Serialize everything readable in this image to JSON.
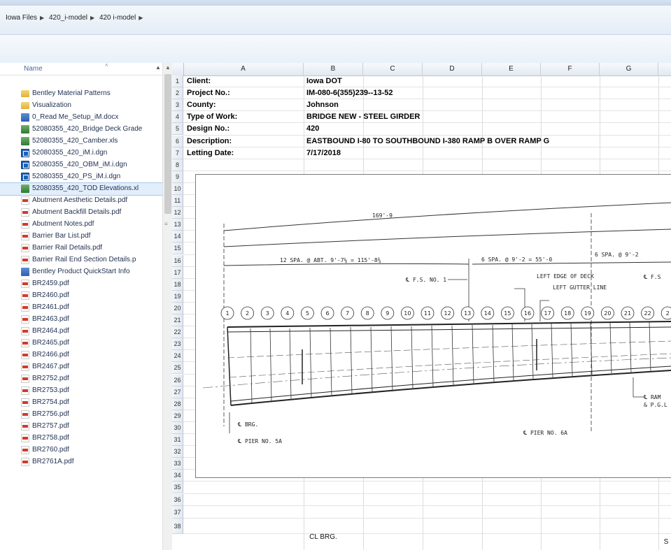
{
  "breadcrumb": [
    "Iowa Files",
    "420_i-model",
    "420 i-model"
  ],
  "file_pane": {
    "header": "Name",
    "items": [
      {
        "name": "Bentley Material Patterns",
        "type": "folder"
      },
      {
        "name": "Visualization",
        "type": "folder"
      },
      {
        "name": "0_Read Me_Setup_iM.docx",
        "type": "doc"
      },
      {
        "name": "52080355_420_Bridge Deck Grade",
        "type": "xls"
      },
      {
        "name": "52080355_420_Camber.xls",
        "type": "xls"
      },
      {
        "name": "52080355_420_iM.i.dgn",
        "type": "dgn"
      },
      {
        "name": "52080355_420_OBM_iM.i.dgn",
        "type": "dgn"
      },
      {
        "name": "52080355_420_PS_iM.i.dgn",
        "type": "dgn"
      },
      {
        "name": "52080355_420_TOD Elevations.xl",
        "type": "xls",
        "selected": true
      },
      {
        "name": "Abutment Aesthetic Details.pdf",
        "type": "pdf"
      },
      {
        "name": "Abutment Backfill Details.pdf",
        "type": "pdf"
      },
      {
        "name": "Abutment Notes.pdf",
        "type": "pdf"
      },
      {
        "name": "Barrier Bar List.pdf",
        "type": "pdf"
      },
      {
        "name": "Barrier Rail Details.pdf",
        "type": "pdf"
      },
      {
        "name": "Barrier Rail End Section Details.p",
        "type": "pdf"
      },
      {
        "name": "Bentley Product QuickStart Info",
        "type": "doc"
      },
      {
        "name": "BR2459.pdf",
        "type": "pdf"
      },
      {
        "name": "BR2460.pdf",
        "type": "pdf"
      },
      {
        "name": "BR2461.pdf",
        "type": "pdf"
      },
      {
        "name": "BR2463.pdf",
        "type": "pdf"
      },
      {
        "name": "BR2464.pdf",
        "type": "pdf"
      },
      {
        "name": "BR2465.pdf",
        "type": "pdf"
      },
      {
        "name": "BR2466.pdf",
        "type": "pdf"
      },
      {
        "name": "BR2467.pdf",
        "type": "pdf"
      },
      {
        "name": "BR2752.pdf",
        "type": "pdf"
      },
      {
        "name": "BR2753.pdf",
        "type": "pdf"
      },
      {
        "name": "BR2754.pdf",
        "type": "pdf"
      },
      {
        "name": "BR2756.pdf",
        "type": "pdf"
      },
      {
        "name": "BR2757.pdf",
        "type": "pdf"
      },
      {
        "name": "BR2758.pdf",
        "type": "pdf"
      },
      {
        "name": "BR2760.pdf",
        "type": "pdf"
      },
      {
        "name": "BR2761A.pdf",
        "type": "pdf"
      }
    ]
  },
  "sheet": {
    "columns": [
      "A",
      "B",
      "C",
      "D",
      "E",
      "F",
      "G"
    ],
    "rows": [
      "1",
      "2",
      "3",
      "4",
      "5",
      "6",
      "7",
      "8",
      "9",
      "10",
      "11",
      "12",
      "13",
      "14",
      "15",
      "16",
      "17",
      "18",
      "19",
      "20",
      "21",
      "22",
      "23",
      "24",
      "25",
      "26",
      "27",
      "28",
      "29",
      "30",
      "31",
      "32",
      "33",
      "34",
      "35",
      "36",
      "37",
      "38"
    ],
    "info": [
      {
        "label": "Client:",
        "value": "Iowa DOT"
      },
      {
        "label": "Project No.:",
        "value": "IM-080-6(355)239--13-52"
      },
      {
        "label": "County:",
        "value": "Johnson"
      },
      {
        "label": "Type of Work:",
        "value": "BRIDGE NEW - STEEL GIRDER"
      },
      {
        "label": "Design No.:",
        "value": "420"
      },
      {
        "label": "Description:",
        "value": "EASTBOUND I-80 TO SOUTHBOUND I-380 RAMP B OVER RAMP G"
      },
      {
        "label": "Letting Date:",
        "value": "7/17/2018"
      }
    ],
    "bottom_cell": "CL BRG.",
    "bottom_right": "S"
  },
  "drawing": {
    "overall_dim": "169'-9",
    "spa1": "12 SPA. @ ABT. 9'-7¼ = 115'-8¾",
    "spa2": "6 SPA. @ 9'-2 = 55'-0",
    "spa3": "6 SPA. @ 9'-2",
    "fs1": "℄ F.S. NO. 1",
    "fs2": "℄ F.S",
    "left_edge": "LEFT EDGE OF DECK",
    "left_gutter": "LEFT GUTTER LINE",
    "brg": "℄ BRG.",
    "pier5a": "℄ PIER NO. 5A",
    "pier6a": "℄ PIER NO. 6A",
    "ramp1": "℄ RAM",
    "ramp2": "& P.G.L",
    "circles": [
      "1",
      "2",
      "3",
      "4",
      "5",
      "6",
      "7",
      "8",
      "9",
      "10",
      "11",
      "12",
      "13",
      "14",
      "15",
      "16",
      "17",
      "18",
      "19",
      "20",
      "21",
      "22",
      "2"
    ]
  }
}
